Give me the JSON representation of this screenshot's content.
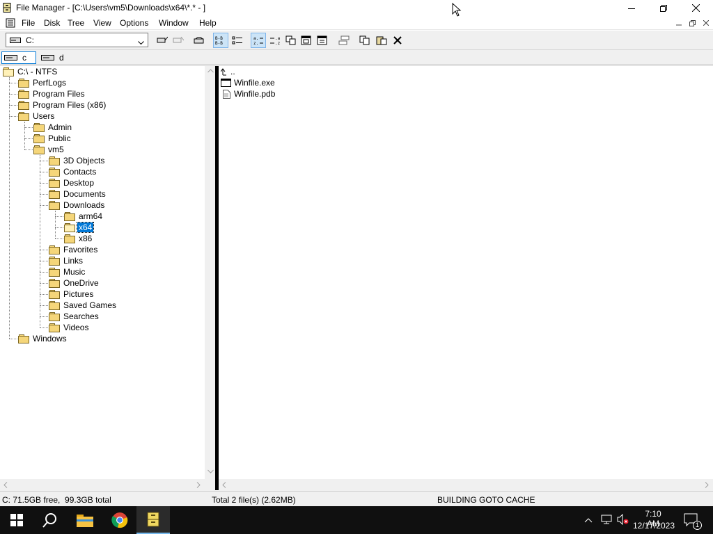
{
  "window": {
    "title": "File Manager - [C:\\Users\\vm5\\Downloads\\x64\\*.* - ]",
    "icons": {
      "app": "file-cabinet-icon",
      "minimize": "minimize-icon",
      "maximize": "restore-icon",
      "close": "close-icon"
    }
  },
  "menu": {
    "items": [
      "File",
      "Disk",
      "Tree",
      "View",
      "Options",
      "Window",
      "Help"
    ]
  },
  "toolbar": {
    "drive_value": "C:",
    "buttons": [
      "connect-network-drive-icon",
      "disconnect-network-drive-icon",
      "share-icon",
      "tree-and-directory-icon",
      "view-details-icon",
      "sort-by-name-icon",
      "sort-by-type-icon",
      "copy-path-icon",
      "new-window-icon",
      "properties-icon",
      "tile-icon",
      "copy-icon",
      "paste-icon",
      "delete-icon"
    ]
  },
  "drives": [
    {
      "label": "c",
      "selected": true
    },
    {
      "label": "d",
      "selected": false
    }
  ],
  "tree": {
    "root": "C:\\ - NTFS",
    "c_children": [
      "PerfLogs",
      "Program Files",
      "Program Files (x86)",
      "Users",
      "Windows"
    ],
    "users_children": [
      "Admin",
      "Public",
      "vm5"
    ],
    "vm5_children": [
      "3D Objects",
      "Contacts",
      "Desktop",
      "Documents",
      "Downloads",
      "Favorites",
      "Links",
      "Music",
      "OneDrive",
      "Pictures",
      "Saved Games",
      "Searches",
      "Videos"
    ],
    "downloads_children": [
      "arm64",
      "x64",
      "x86"
    ],
    "selected": "x64"
  },
  "files": {
    "up": "..",
    "items": [
      {
        "name": "Winfile.exe",
        "icon": "executable-file-icon"
      },
      {
        "name": "Winfile.pdb",
        "icon": "document-file-icon"
      }
    ]
  },
  "status": {
    "disk": "C: 71.5GB free,  99.3GB total",
    "total": "Total 2 file(s) (2.62MB)",
    "message": "BUILDING GOTO CACHE"
  },
  "taskbar": {
    "time": "7:10 AM",
    "date": "12/17/2023",
    "notifications": "1"
  },
  "colors": {
    "selection": "#0078d7",
    "taskbar": "#101010",
    "folder": "#f5d67a"
  }
}
